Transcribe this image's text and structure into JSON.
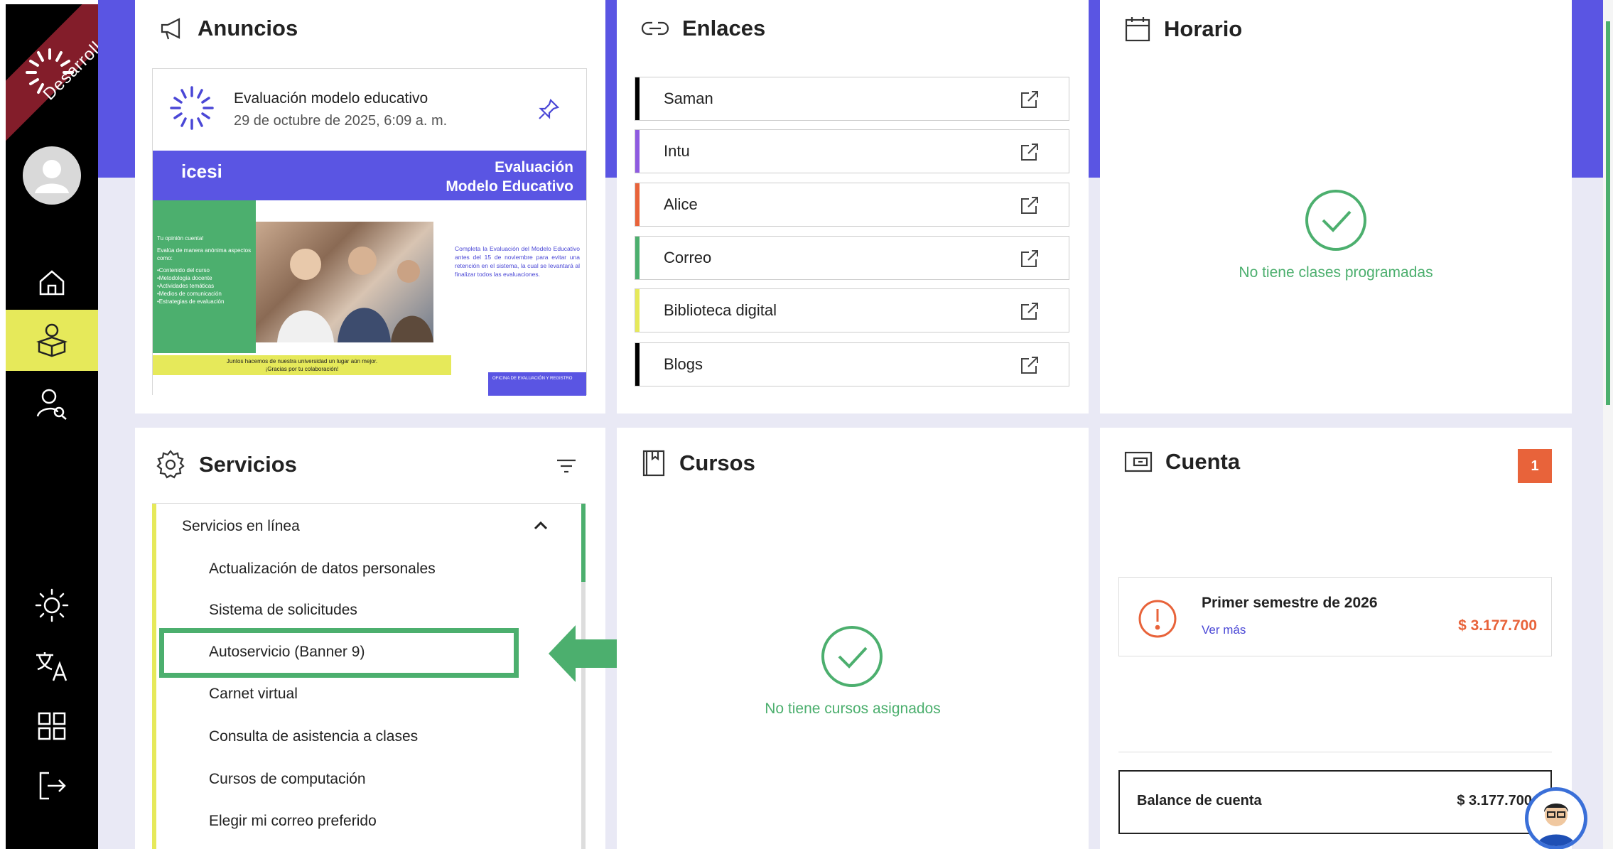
{
  "sidebar": {
    "ribbon_label": "Desarrollo",
    "icons": [
      "home-icon",
      "student-icon",
      "user-search-icon",
      "theme-icon",
      "language-icon",
      "apps-icon",
      "logout-icon"
    ],
    "active_color": "#e6e95a"
  },
  "anuncios": {
    "title": "Anuncios",
    "item": {
      "title": "Evaluación modelo educativo",
      "date": "29 de octubre de 2025, 6:09 a. m.",
      "banner": {
        "brand": "icesi",
        "heading_line1": "Evaluación",
        "heading_line2": "Modelo Educativo",
        "left_text_title": "Tu opinión cuenta!",
        "left_text_body": "Evalúa de manera anónima aspectos como:",
        "left_list": [
          "•Contenido del curso",
          "•Metodología docente",
          "•Actividades temáticas",
          "•Medios de comunicación",
          "•Estrategias de evaluación"
        ],
        "right_text": "Completa la Evaluación del Modelo Educativo antes del 15 de noviembre para evitar una retención en el sistema, la cual se levantará al finalizar todos las evaluaciones.",
        "footer_line1": "Juntos hacemos de nuestra universidad un lugar aún mejor.",
        "footer_line2": "¡Gracias por tu colaboración!",
        "footer_right": "OFICINA DE EVALUACIÓN Y REGISTRO"
      }
    }
  },
  "enlaces": {
    "title": "Enlaces",
    "links": [
      {
        "label": "Saman",
        "color": "#000000"
      },
      {
        "label": "Intu",
        "color": "#8e5be0"
      },
      {
        "label": "Alice",
        "color": "#e8633a"
      },
      {
        "label": "Correo",
        "color": "#4caf6e"
      },
      {
        "label": "Biblioteca digital",
        "color": "#e6e95a"
      },
      {
        "label": "Blogs",
        "color": "#000000"
      }
    ]
  },
  "horario": {
    "title": "Horario",
    "empty": "No tiene clases programadas"
  },
  "servicios": {
    "title": "Servicios",
    "group": "Servicios en línea",
    "items": [
      "Actualización de datos personales",
      "Sistema de solicitudes",
      "Autoservicio (Banner 9)",
      "Carnet virtual",
      "Consulta de asistencia a clases",
      "Cursos de computación",
      "Elegir mi correo preferido"
    ],
    "highlight_color": "#4caf6e"
  },
  "cursos": {
    "title": "Cursos",
    "empty": "No tiene cursos asignados"
  },
  "cuenta": {
    "title": "Cuenta",
    "badge": "1",
    "semester": "Primer semestre de 2026",
    "more": "Ver más",
    "amount": "$ 3.177.700",
    "balance_label": "Balance de cuenta",
    "balance_amount": "$ 3.177.700"
  },
  "colors": {
    "accent": "#5a55e3",
    "green": "#4caf6e",
    "orange": "#e8633a",
    "yellow": "#e6e95a"
  }
}
